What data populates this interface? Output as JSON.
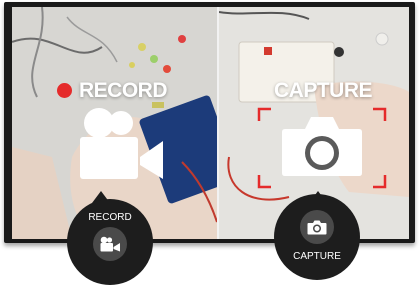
{
  "record": {
    "label": "RECORD",
    "button_caption": "RECORD",
    "dot_color": "#e52b2b",
    "icon": "video-camera-icon"
  },
  "capture": {
    "label": "CAPTURE",
    "button_caption": "CAPTURE",
    "frame_color": "#e52b2b",
    "icon": "camera-icon"
  },
  "colors": {
    "overlay_icon": "#ffffff",
    "button_bg": "#1d1d1d",
    "button_inner": "#4a4a4a"
  }
}
